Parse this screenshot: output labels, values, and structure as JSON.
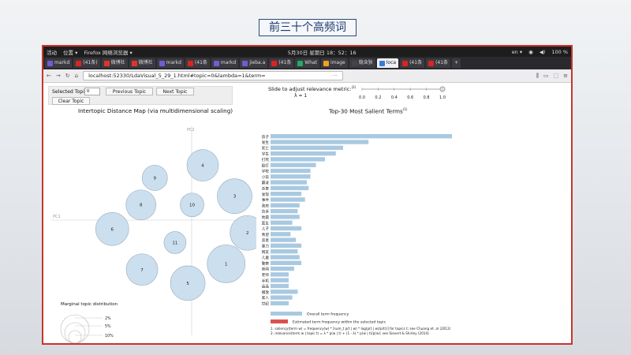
{
  "slide": {
    "title": "前三十个高频词"
  },
  "system": {
    "activities": "活动",
    "places": "位置 ▾",
    "app": "Firefox 网络浏览器 ▾",
    "clock": "5月30日 星期日 18：52：16",
    "lang": "en ▾",
    "battery": "100 %"
  },
  "tabs": [
    {
      "label": "markd",
      "color": "#6b5fd3"
    },
    {
      "label": "(41条)",
      "color": "#d22"
    },
    {
      "label": "微博社",
      "color": "#e0342a"
    },
    {
      "label": "微博社",
      "color": "#e0342a"
    },
    {
      "label": "markd",
      "color": "#6b5fd3"
    },
    {
      "label": "(41条",
      "color": "#d22"
    },
    {
      "label": "markd",
      "color": "#6b5fd3"
    },
    {
      "label": "jieba.a",
      "color": "#6b5fd3"
    },
    {
      "label": "(41条",
      "color": "#d22"
    },
    {
      "label": "What",
      "color": "#2a6"
    },
    {
      "label": "image",
      "color": "#f0a020"
    },
    {
      "label": "隐含狄",
      "color": "#444"
    },
    {
      "label": "loca",
      "color": "#3a7bd5",
      "active": true
    },
    {
      "label": "(41条",
      "color": "#d22"
    },
    {
      "label": "(41条",
      "color": "#d22"
    }
  ],
  "nav": {
    "url": "localhost:52330/LdaVisual_5_29_1.html#topic=0&lambda=1&term=",
    "dots": "···"
  },
  "controls": {
    "selected_topic_label": "Selected Topic:",
    "selected_topic_value": "0",
    "prev": "Previous Topic",
    "next": "Next Topic",
    "clear": "Clear Topic",
    "slider_label": "Slide to adjust relevance metric:",
    "slider_sup": "(2)",
    "lambda_label": "λ = 1",
    "slider_ticks": [
      "0.0",
      "0.2",
      "0.4",
      "0.6",
      "0.8",
      "1.0"
    ]
  },
  "left_chart": {
    "title": "Intertopic Distance Map (via multidimensional scaling)",
    "axis_pc1": "PC1",
    "axis_pc2": "PC2",
    "marginal_title": "Marginal topic distribution",
    "marginal_labels": [
      "2%",
      "5%",
      "10%"
    ]
  },
  "chart_data": [
    {
      "type": "scatter",
      "title": "Intertopic Distance Map (via multidimensional scaling)",
      "points": [
        {
          "label": "1",
          "x": 0.42,
          "y": -0.42,
          "size": 24
        },
        {
          "label": "2",
          "x": 0.62,
          "y": -0.1,
          "size": 22
        },
        {
          "label": "3",
          "x": 0.5,
          "y": 0.28,
          "size": 22
        },
        {
          "label": "4",
          "x": 0.2,
          "y": 0.6,
          "size": 20
        },
        {
          "label": "5",
          "x": 0.06,
          "y": -0.62,
          "size": 22
        },
        {
          "label": "6",
          "x": -0.65,
          "y": -0.06,
          "size": 21
        },
        {
          "label": "7",
          "x": -0.37,
          "y": -0.48,
          "size": 20
        },
        {
          "label": "8",
          "x": -0.38,
          "y": 0.19,
          "size": 19
        },
        {
          "label": "9",
          "x": -0.25,
          "y": 0.47,
          "size": 16
        },
        {
          "label": "10",
          "x": 0.1,
          "y": 0.19,
          "size": 15
        },
        {
          "label": "11",
          "x": -0.06,
          "y": -0.2,
          "size": 14
        }
      ]
    },
    {
      "type": "bar",
      "title": "Top-30 Most Salient Terms",
      "title_sup": "(1)",
      "categories": [
        "孩子",
        "发生",
        "死亡",
        "学生",
        "打死",
        "殴打",
        "学校",
        "小孩",
        "霸凌",
        "杀害",
        "发现",
        "事件",
        "政府",
        "告诉",
        "地震",
        "医生",
        "儿子",
        "希望",
        "恶意",
        "暴力",
        "网友",
        "儿童",
        "警察",
        "新闻",
        "老师",
        "手机",
        "晶晶",
        "播放",
        "家人",
        "世纪"
      ],
      "values": [
        100,
        54,
        40,
        36,
        30,
        25,
        22,
        22,
        20,
        21,
        17,
        19,
        16,
        15,
        16,
        12,
        17,
        11,
        14,
        17,
        15,
        16,
        17,
        13,
        10,
        10,
        10,
        15,
        12,
        10
      ],
      "legend": [
        "Overall term frequency",
        "Estimated term frequency within the selected topic"
      ],
      "footnotes": [
        "1. saliency(term w) = frequency(w) * [sum_t p(t | w) * log(p(t | w)/p(t))] for topics t; see Chuang et. al (2012)",
        "2. relevance(term w | topic t) = λ * p(w | t) + (1 - λ) * p(w | t)/p(w); see Sievert & Shirley (2014)"
      ]
    }
  ],
  "colors": {
    "bubble": "#c6dbec",
    "bar": "#a9c9e1",
    "red_bar": "#d9534f",
    "frame": "#c9342c"
  }
}
